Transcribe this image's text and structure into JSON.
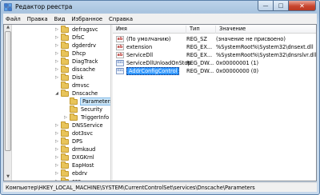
{
  "window": {
    "title": "Редактор реестра",
    "icon": "registry-editor-icon",
    "controls": {
      "minimize": "—",
      "maximize": "□",
      "close": "✕"
    }
  },
  "menu": [
    "Файл",
    "Правка",
    "Вид",
    "Избранное",
    "Справка"
  ],
  "tree": {
    "nodes": [
      {
        "label": "defragsvc",
        "expander": "▷",
        "selected": false
      },
      {
        "label": "DfsC",
        "expander": "▷",
        "selected": false
      },
      {
        "label": "dgderdrv",
        "expander": "▷",
        "selected": false
      },
      {
        "label": "Dhcp",
        "expander": "▷",
        "selected": false
      },
      {
        "label": "DiagTrack",
        "expander": "▷",
        "selected": false
      },
      {
        "label": "discache",
        "expander": "▷",
        "selected": false
      },
      {
        "label": "Disk",
        "expander": "▷",
        "selected": false
      },
      {
        "label": "dmvsc",
        "expander": "",
        "selected": false
      },
      {
        "label": "Dnscache",
        "expander": "◢",
        "selected": false
      },
      {
        "label": "Parameters",
        "expander": "",
        "selected": true
      },
      {
        "label": "Security",
        "expander": "",
        "selected": false
      },
      {
        "label": "TriggerInfo",
        "expander": "▷",
        "selected": false
      },
      {
        "label": "DNSService",
        "expander": "▷",
        "selected": false
      },
      {
        "label": "dot3svc",
        "expander": "▷",
        "selected": false
      },
      {
        "label": "DPS",
        "expander": "▷",
        "selected": false
      },
      {
        "label": "drmkaud",
        "expander": "▷",
        "selected": false
      },
      {
        "label": "DXGKrnl",
        "expander": "▷",
        "selected": false
      },
      {
        "label": "EapHost",
        "expander": "▷",
        "selected": false
      },
      {
        "label": "ebdrv",
        "expander": "▷",
        "selected": false
      },
      {
        "label": "ccc",
        "expander": "▷",
        "selected": false
      }
    ]
  },
  "values": {
    "columns": [
      "Имя",
      "Тип",
      "Значение"
    ],
    "rows": [
      {
        "icon": "ab",
        "name": "(По умолчанию)",
        "type": "REG_SZ",
        "data": "(значение не присвоено)",
        "selected": false
      },
      {
        "icon": "ab",
        "name": "extension",
        "type": "REG_EX...",
        "data": "%SystemRoot%\\System32\\dnsext.dll",
        "selected": false
      },
      {
        "icon": "ab",
        "name": "ServiceDll",
        "type": "REG_EX...",
        "data": "%SystemRoot%\\System32\\dnsrslvr.dll",
        "selected": false
      },
      {
        "icon": "bin",
        "name": "ServiceDllUnloadOnStop",
        "type": "REG_DW...",
        "data": "0x00000001 (1)",
        "selected": false
      },
      {
        "icon": "bin",
        "name": "AddrConfigControl",
        "type": "REG_DW...",
        "data": "0x00000000 (0)",
        "selected": true
      }
    ]
  },
  "status": "Компьютер\\HKEY_LOCAL_MACHINE\\SYSTEM\\CurrentControlSet\\services\\Dnscache\\Parameters"
}
